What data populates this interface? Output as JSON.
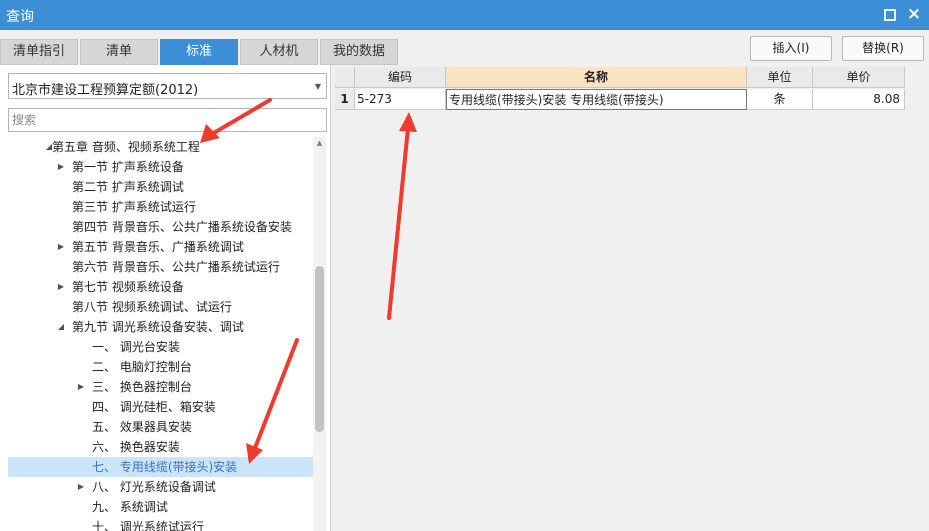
{
  "window": {
    "title": "查询"
  },
  "tabs": [
    {
      "label": "清单指引",
      "active": false
    },
    {
      "label": "清单",
      "active": false
    },
    {
      "label": "标准",
      "active": true
    },
    {
      "label": "人材机",
      "active": false
    },
    {
      "label": "我的数据",
      "active": false
    }
  ],
  "buttons": {
    "insert": "插入(I)",
    "replace": "替换(R)"
  },
  "quota_select": {
    "value": "北京市建设工程预算定额(2012)"
  },
  "search": {
    "placeholder": "搜索",
    "value": ""
  },
  "tree": [
    {
      "label": "第五章 音频、视频系统工程",
      "toggle": "expanded",
      "level": 0
    },
    {
      "label": "第一节 扩声系统设备",
      "toggle": "collapsed",
      "level": 1
    },
    {
      "label": "第二节 扩声系统调试",
      "toggle": "none",
      "level": 1
    },
    {
      "label": "第三节 扩声系统试运行",
      "toggle": "none",
      "level": 1
    },
    {
      "label": "第四节 背景音乐、公共广播系统设备安装",
      "toggle": "none",
      "level": 1
    },
    {
      "label": "第五节 背景音乐、广播系统调试",
      "toggle": "collapsed",
      "level": 1
    },
    {
      "label": "第六节 背景音乐、公共广播系统试运行",
      "toggle": "none",
      "level": 1
    },
    {
      "label": "第七节 视频系统设备",
      "toggle": "collapsed",
      "level": 1
    },
    {
      "label": "第八节 视频系统调试、试运行",
      "toggle": "none",
      "level": 1
    },
    {
      "label": "第九节 调光系统设备安装、调试",
      "toggle": "expanded",
      "level": 1
    },
    {
      "label": "一、 调光台安装",
      "toggle": "none",
      "level": 2
    },
    {
      "label": "二、 电脑灯控制台",
      "toggle": "none",
      "level": 2
    },
    {
      "label": "三、 换色器控制台",
      "toggle": "collapsed",
      "level": 2
    },
    {
      "label": "四、 调光硅柜、箱安装",
      "toggle": "none",
      "level": 2
    },
    {
      "label": "五、 效果器具安装",
      "toggle": "none",
      "level": 2
    },
    {
      "label": "六、 换色器安装",
      "toggle": "none",
      "level": 2
    },
    {
      "label": "七、 专用线缆(带接头)安装",
      "toggle": "none",
      "level": 2,
      "selected": true
    },
    {
      "label": "八、 灯光系统设备调试",
      "toggle": "collapsed",
      "level": 2
    },
    {
      "label": "九、 系统调试",
      "toggle": "none",
      "level": 2
    },
    {
      "label": "十、 调光系统试运行",
      "toggle": "none",
      "level": 2
    }
  ],
  "table": {
    "headers": {
      "code": "编码",
      "name": "名称",
      "unit": "单位",
      "price": "单价"
    },
    "rows": [
      {
        "num": "1",
        "code": "5-273",
        "name": "专用线缆(带接头)安装 专用线缆(带接头)",
        "unit": "条",
        "price": "8.08"
      }
    ]
  },
  "colors": {
    "accent": "#3c8fd6",
    "selected_row": "#cce4f7",
    "name_header": "#fbe3c2",
    "annotation": "#f03a2e"
  }
}
